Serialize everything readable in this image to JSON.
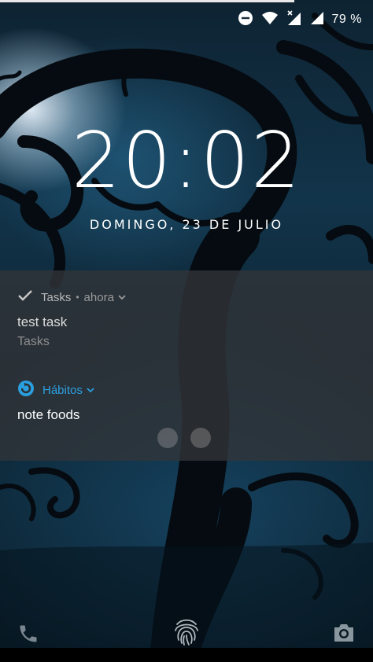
{
  "status_bar": {
    "battery_text": "79 %",
    "icons": [
      "dnd-icon",
      "wifi-icon",
      "signal-icon",
      "signal-icon",
      "battery-icon"
    ]
  },
  "lockscreen": {
    "time": "20:02",
    "date": "DOMINGO, 23 DE JULIO"
  },
  "notifications": [
    {
      "app_name": "Tasks",
      "time": "ahora",
      "title": "test task",
      "text": "Tasks",
      "icon": "check-icon"
    },
    {
      "app_name": "Hábitos",
      "title": "note foods",
      "icon": "habit-loop-icon",
      "accent": "#2a9fe0"
    }
  ],
  "bottom": {
    "icons": [
      "phone-icon",
      "fingerprint-icon",
      "camera-icon"
    ]
  }
}
